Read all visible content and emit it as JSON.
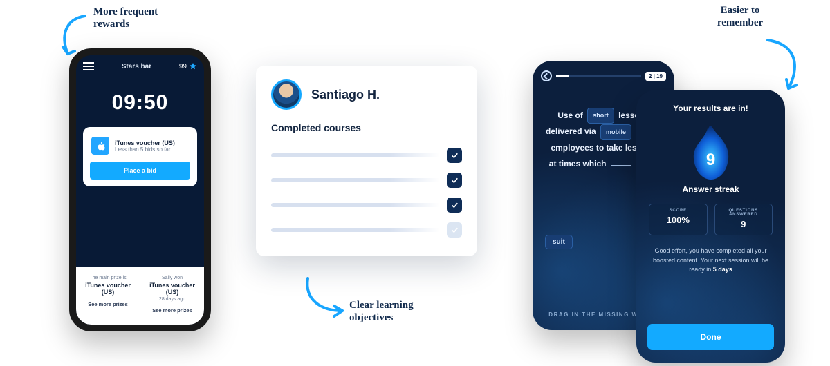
{
  "callouts": {
    "rewards": "More frequent rewards",
    "objectives": "Clear learning objectives",
    "remember": "Easier to remember"
  },
  "phone1": {
    "stars_bar_label": "Stars bar",
    "stars_count": "99",
    "timer": "09:50",
    "reward": {
      "title": "iTunes voucher (US)",
      "subtitle": "Less than 5 bids so far",
      "button": "Place a bid"
    },
    "bottom_left": {
      "over": "The main prize is",
      "main": "iTunes voucher (US)",
      "sub": "",
      "link": "See more prizes"
    },
    "bottom_right": {
      "over": "Sally won",
      "main": "iTunes voucher (US)",
      "sub": "28 days ago",
      "link": "See more prizes"
    }
  },
  "card": {
    "name": "Santiago H.",
    "section": "Completed courses",
    "rows": [
      {
        "done": true
      },
      {
        "done": true
      },
      {
        "done": true
      },
      {
        "done": false
      }
    ]
  },
  "phone2": {
    "progress_counter": "2 | 19",
    "line1_pre": "Use of",
    "token_short": "short",
    "line1_post": "lessons",
    "line2_pre": "delivered via",
    "token_mobile": "mobile",
    "line2_post": "allows",
    "line3": "employees to take lessons",
    "line4_pre": "at times which",
    "line4_post": "them.",
    "chip": "suit",
    "drag_hint": "DRAG IN THE MISSING WORDS"
  },
  "phone3": {
    "title": "Your results are in!",
    "streak_number": "9",
    "streak_label": "Answer streak",
    "stat1_label": "Score",
    "stat1_value": "100%",
    "stat2_label": "Questions answered",
    "stat2_value": "9",
    "summary_pre": "Good effort, you have completed all your boosted content. Your next session will be ready in ",
    "summary_bold": "5 days",
    "done": "Done"
  }
}
